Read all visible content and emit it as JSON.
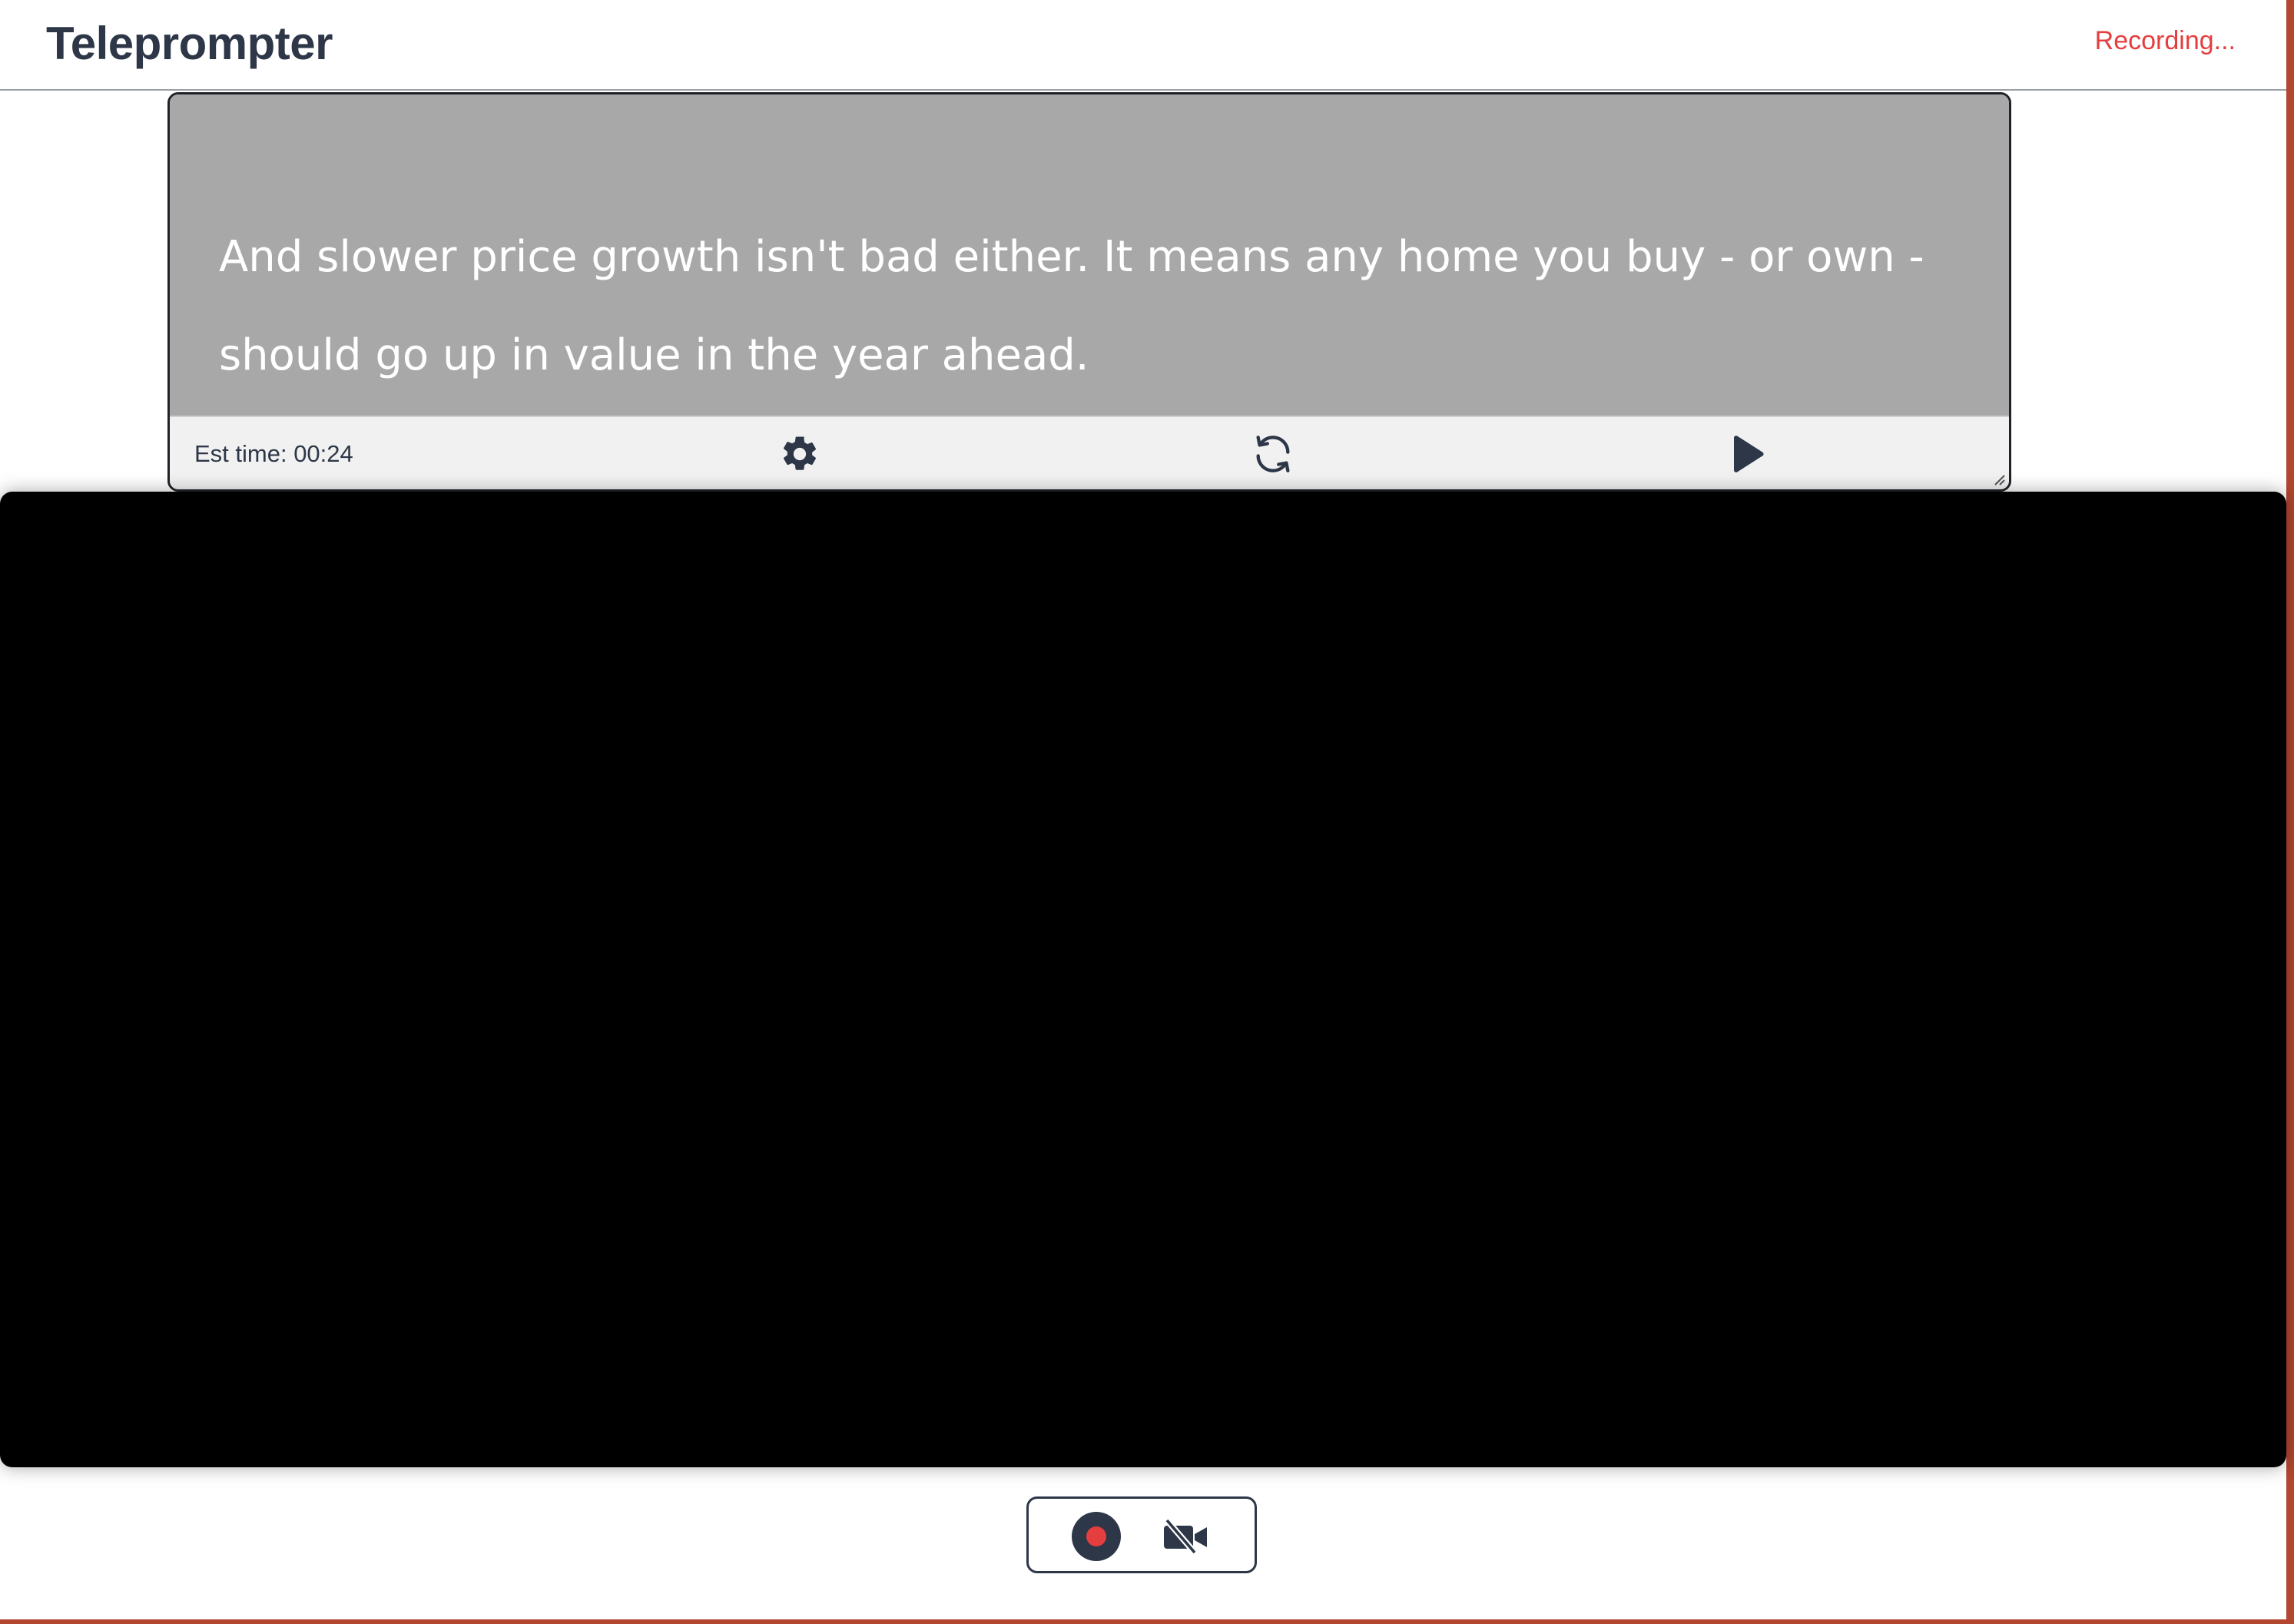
{
  "header": {
    "title": "Teleprompter",
    "status": "Recording..."
  },
  "prompter": {
    "script_text": "And slower price growth isn't bad either. It means any home you buy - or own - should go up in value in the year ahead.",
    "est_time_label": "Est time: 00:24",
    "icons": {
      "settings": "gear-icon",
      "reset": "refresh-icon",
      "play": "play-icon"
    }
  },
  "record_controls": {
    "icons": {
      "record": "record-icon",
      "camera": "video-off-icon"
    }
  },
  "colors": {
    "text": "#2d3748",
    "status": "#e53e3e",
    "script_bg": "#a8a8a8",
    "video_bg": "#000000",
    "record_dot": "#e53e3e"
  }
}
